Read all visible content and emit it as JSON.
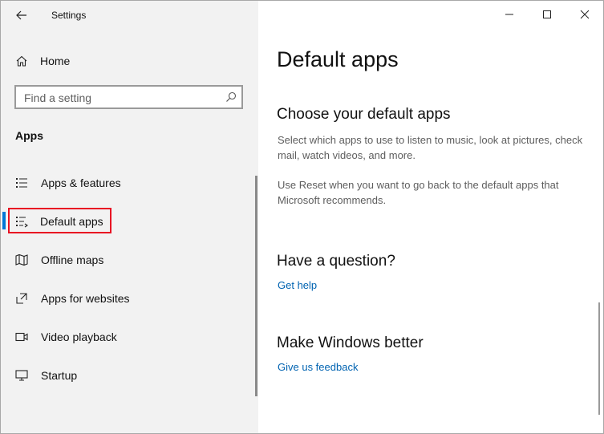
{
  "window": {
    "title": "Settings"
  },
  "sidebar": {
    "home_label": "Home",
    "search": {
      "placeholder": "Find a setting",
      "value": ""
    },
    "section_title": "Apps",
    "items": [
      {
        "label": "Apps & features",
        "icon": "list-icon"
      },
      {
        "label": "Default apps",
        "icon": "default-apps-icon",
        "selected": true
      },
      {
        "label": "Offline maps",
        "icon": "map-icon"
      },
      {
        "label": "Apps for websites",
        "icon": "open-link-icon"
      },
      {
        "label": "Video playback",
        "icon": "video-icon"
      },
      {
        "label": "Startup",
        "icon": "monitor-icon"
      }
    ]
  },
  "main": {
    "title": "Default apps",
    "choose_heading": "Choose your default apps",
    "choose_text": "Select which apps to use to listen to music, look at pictures, check mail, watch videos, and more.",
    "reset_text": "Use Reset when you want to go back to the default apps that Microsoft recommends.",
    "question_heading": "Have a question?",
    "get_help_link": "Get help",
    "better_heading": "Make Windows better",
    "feedback_link": "Give us feedback"
  },
  "colors": {
    "accent": "#0078d7",
    "highlight_box": "#e81123",
    "link": "#0063b1",
    "sidebar_bg": "#f2f2f2"
  }
}
